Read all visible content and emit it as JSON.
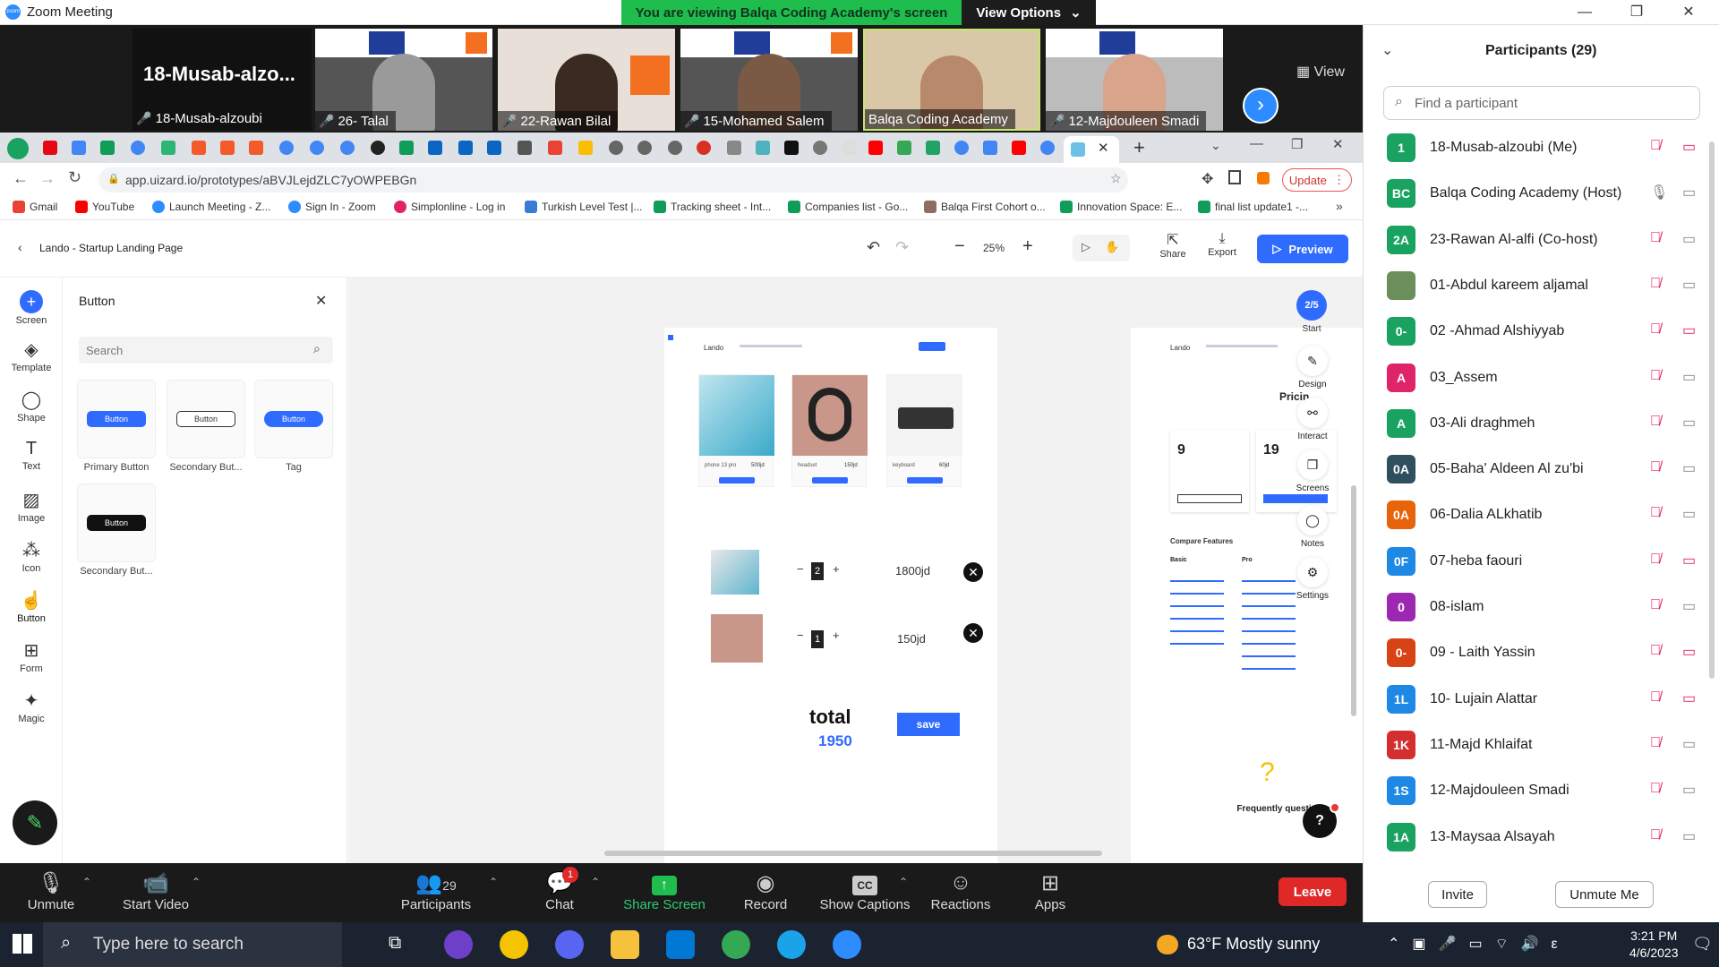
{
  "window": {
    "title": "Zoom Meeting"
  },
  "banner": {
    "message": "You are viewing Balqa Coding Academy's screen",
    "options_label": "View Options"
  },
  "video": {
    "active_speaker": "18-Musab-alzo...",
    "view_label": "View",
    "tiles": [
      {
        "name": "18-Musab-alzoubi",
        "muted": true
      },
      {
        "name": "26- Talal",
        "muted": true
      },
      {
        "name": "22-Rawan Bilal",
        "muted": true
      },
      {
        "name": "15-Mohamed Salem",
        "muted": true
      },
      {
        "name": "Balqa Coding Academy",
        "muted": false
      },
      {
        "name": "12-Majdouleen Smadi",
        "muted": true
      }
    ]
  },
  "browser": {
    "url": "app.uizard.io/prototypes/aBVJLejdZLC7yOWPEBGn",
    "update_label": "Update",
    "bookmarks": [
      "Gmail",
      "YouTube",
      "Launch Meeting - Z...",
      "Sign In - Zoom",
      "Simplonline - Log in",
      "Turkish Level Test |...",
      "Tracking sheet - Int...",
      "Companies list - Go...",
      "Balqa First Cohort o...",
      "Innovation Space: E...",
      "final list update1 -..."
    ]
  },
  "uizard": {
    "project_title": "Lando - Startup Landing Page",
    "zoom_level": "25%",
    "share_label": "Share",
    "export_label": "Export",
    "preview_label": "Preview",
    "rail": [
      "Screen",
      "Template",
      "Shape",
      "Text",
      "Image",
      "Icon",
      "Button",
      "Form",
      "Magic"
    ],
    "panel": {
      "title": "Button",
      "search_placeholder": "Search",
      "components": [
        {
          "label": "Primary Button",
          "button_text": "Button"
        },
        {
          "label": "Secondary But...",
          "button_text": "Button"
        },
        {
          "label": "Tag",
          "button_text": "Button"
        },
        {
          "label": "Secondary But...",
          "button_text": "Button"
        }
      ]
    },
    "screen_counter": "2/5",
    "right_tools": [
      "Start",
      "Design",
      "Interact",
      "Screens",
      "Notes",
      "Settings"
    ],
    "mockup": {
      "brand": "Lando",
      "products": [
        {
          "name": "phone 13 pro",
          "price": "500jd"
        },
        {
          "name": "headset",
          "price": "150jd"
        },
        {
          "name": "keyboard",
          "price": "60jd"
        }
      ],
      "cart": [
        {
          "qty": "2",
          "price": "1800jd"
        },
        {
          "qty": "1",
          "price": "150jd"
        }
      ],
      "total_label": "total",
      "total_value": "1950",
      "save_label": "save"
    },
    "mockup2": {
      "heading": "Pricin",
      "compare": "Compare Features",
      "col_basic": "Basic",
      "col_pro": "Pro",
      "price_basic": "9",
      "price_pro": "19",
      "faq": "Frequently questi"
    }
  },
  "zoom_toolbar": {
    "unmute": "Unmute",
    "start_video": "Start Video",
    "participants": "Participants",
    "participant_count": "29",
    "chat": "Chat",
    "chat_badge": "1",
    "share": "Share Screen",
    "record": "Record",
    "captions": "Show Captions",
    "reactions": "Reactions",
    "apps": "Apps",
    "leave": "Leave"
  },
  "participants": {
    "title": "Participants (29)",
    "search_placeholder": "Find a participant",
    "invite": "Invite",
    "unmute_me": "Unmute Me",
    "list": [
      {
        "initials": "1",
        "name": "18-Musab-alzoubi (Me)",
        "color": "#1aa260",
        "mic": "muted",
        "cam": "off"
      },
      {
        "initials": "BC",
        "name": "Balqa Coding Academy (Host)",
        "color": "#1aa260",
        "mic": "on",
        "cam": "on"
      },
      {
        "initials": "2A",
        "name": "23-Rawan Al-alfi (Co-host)",
        "color": "#1aa260",
        "mic": "muted",
        "cam": "on"
      },
      {
        "initials": "",
        "name": "01-Abdul kareem aljamal",
        "color": "#6b8f5a",
        "mic": "muted",
        "cam": "on"
      },
      {
        "initials": "0-",
        "name": "02 -Ahmad  Alshiyyab",
        "color": "#1aa260",
        "mic": "muted",
        "cam": "off"
      },
      {
        "initials": "A",
        "name": "03_Assem",
        "color": "#e0246a",
        "mic": "muted",
        "cam": "on"
      },
      {
        "initials": "A",
        "name": "03-Ali draghmeh",
        "color": "#1aa260",
        "mic": "muted",
        "cam": "on"
      },
      {
        "initials": "0A",
        "name": "05-Baha' Aldeen Al zu'bi",
        "color": "#2f4f5f",
        "mic": "muted",
        "cam": "on"
      },
      {
        "initials": "0A",
        "name": "06-Dalia ALkhatib",
        "color": "#e8630a",
        "mic": "muted",
        "cam": "on"
      },
      {
        "initials": "0F",
        "name": "07-heba faouri",
        "color": "#1e88e5",
        "mic": "muted",
        "cam": "off"
      },
      {
        "initials": "0",
        "name": "08-islam",
        "color": "#9c27b0",
        "mic": "muted",
        "cam": "on"
      },
      {
        "initials": "0-",
        "name": "09 - Laith Yassin",
        "color": "#d84315",
        "mic": "muted",
        "cam": "off"
      },
      {
        "initials": "1L",
        "name": "10- Lujain Alattar",
        "color": "#1e88e5",
        "mic": "muted",
        "cam": "off"
      },
      {
        "initials": "1K",
        "name": "11-Majd Khlaifat",
        "color": "#d32f2f",
        "mic": "muted",
        "cam": "on"
      },
      {
        "initials": "1S",
        "name": "12-Majdouleen Smadi",
        "color": "#1e88e5",
        "mic": "muted",
        "cam": "on"
      },
      {
        "initials": "1A",
        "name": "13-Maysaa Alsayah",
        "color": "#1aa260",
        "mic": "muted",
        "cam": "on"
      }
    ]
  },
  "taskbar": {
    "search_placeholder": "Type here to search",
    "weather": "63°F  Mostly sunny",
    "time": "3:21 PM",
    "date": "4/6/2023"
  }
}
